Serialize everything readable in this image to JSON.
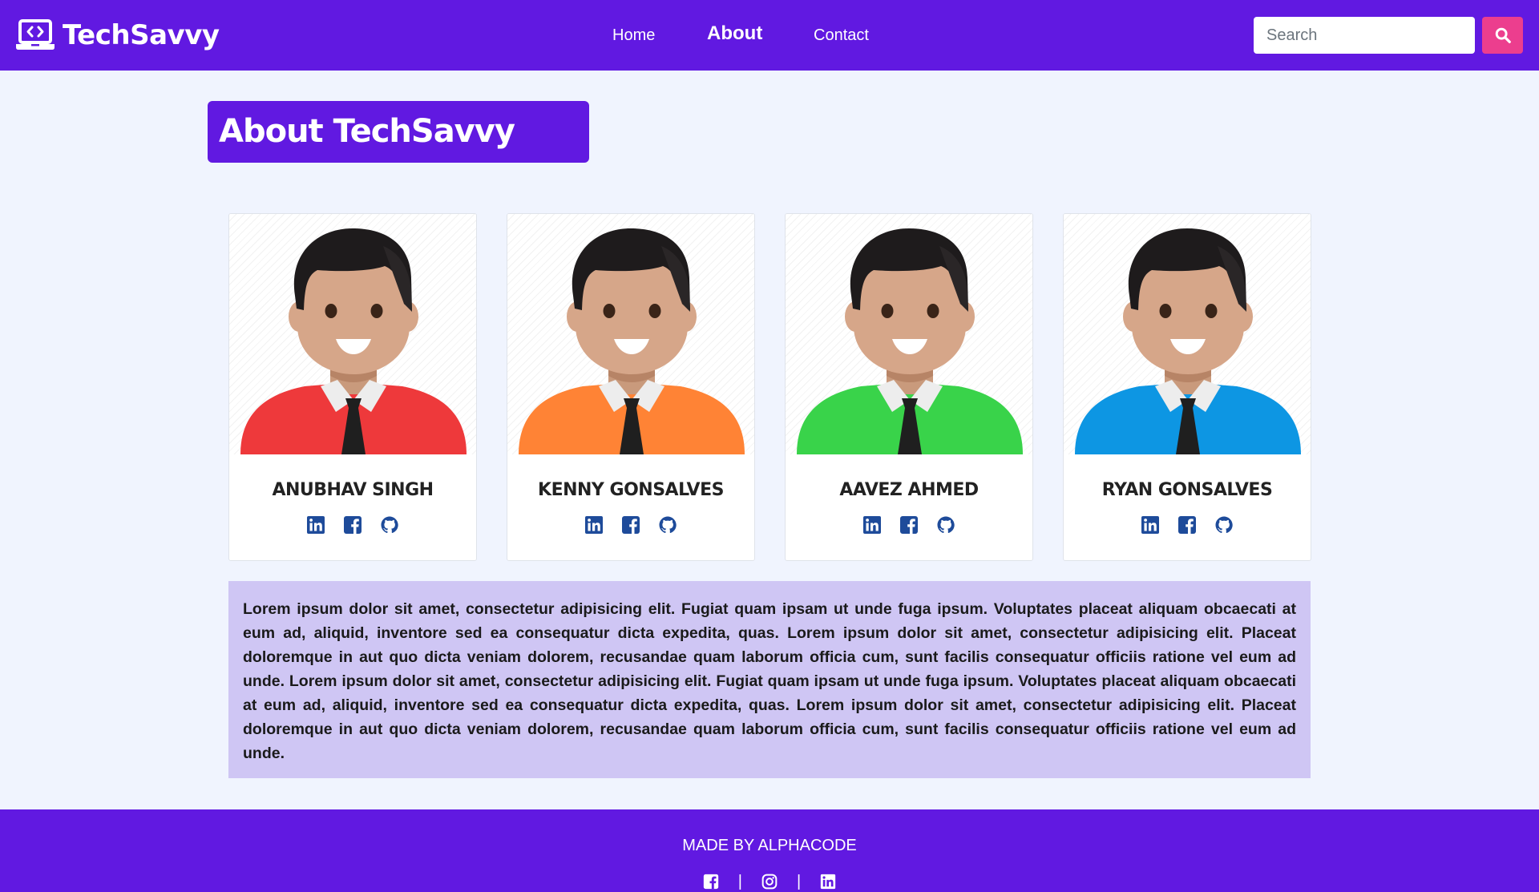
{
  "navbar": {
    "brand": "TechSavvy",
    "links": [
      {
        "label": "Home",
        "active": false
      },
      {
        "label": "About",
        "active": true
      },
      {
        "label": "Contact",
        "active": false
      }
    ],
    "search_placeholder": "Search"
  },
  "page_title": "About TechSavvy",
  "team": [
    {
      "name": "ANUBHAV SINGH",
      "shirt_color": "#ee393b"
    },
    {
      "name": "KENNY GONSALVES",
      "shirt_color": "#ff8335"
    },
    {
      "name": "AAVEZ AHMED",
      "shirt_color": "#39d34a"
    },
    {
      "name": "RYAN GONSALVES",
      "shirt_color": "#0d96e3"
    }
  ],
  "card_social_icons": [
    "linkedin-icon",
    "facebook-icon",
    "github-icon"
  ],
  "about_text": "Lorem ipsum dolor sit amet, consectetur adipisicing elit. Fugiat quam ipsam ut unde fuga ipsum. Voluptates placeat aliquam obcaecati at eum ad, aliquid, inventore sed ea consequatur dicta expedita, quas. Lorem ipsum dolor sit amet, consectetur adipisicing elit. Placeat doloremque in aut quo dicta veniam dolorem, recusandae quam laborum officia cum, sunt facilis consequatur officiis ratione vel eum ad unde. Lorem ipsum dolor sit amet, consectetur adipisicing elit. Fugiat quam ipsam ut unde fuga ipsum. Voluptates placeat aliquam obcaecati at eum ad, aliquid, inventore sed ea consequatur dicta expedita, quas. Lorem ipsum dolor sit amet, consectetur adipisicing elit. Placeat doloremque in aut quo dicta veniam dolorem, recusandae quam laborum officia cum, sunt facilis consequatur officiis ratione vel eum ad unde.",
  "footer": {
    "text": "MADE BY ALPHACODE",
    "separator": "|",
    "socials": [
      "facebook-icon",
      "instagram-icon",
      "linkedin-icon"
    ]
  },
  "colors": {
    "primary": "#6119e1",
    "accent": "#ec3e8e",
    "page_background": "#f0f4fe",
    "text_box_background": "#cfc6f4",
    "social_icon": "#1e4b9a"
  }
}
